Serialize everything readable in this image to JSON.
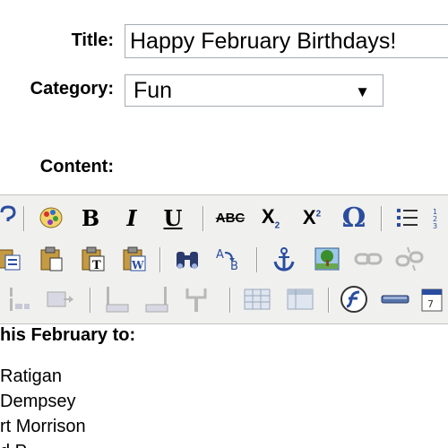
{
  "form": {
    "title_label": "Title:",
    "title_value": "Happy February Birthdays!",
    "category_label": "Category:",
    "category_value": "Fun",
    "content_label": "Content:"
  },
  "toolbar": {
    "row1": [
      "help-icon",
      "colors-icon",
      "bold",
      "italic",
      "underline",
      "strikethrough",
      "subscript",
      "superscript",
      "special-char",
      "bulleted-list",
      "numbered-list"
    ],
    "row2": [
      "paste-icon",
      "paste-icon",
      "paste-text-icon",
      "paste-word-icon",
      "find-icon",
      "replace-icon",
      "anchor-icon",
      "image-icon",
      "link-icon",
      "unlink-icon"
    ],
    "row3": [
      "table-row-icon",
      "table-col-icon",
      "table-merge-icon",
      "table-split-icon",
      "table-insert-icon",
      "table-icon",
      "table-props-icon",
      "flash-icon",
      "horizontal-rule-icon",
      "date-icon"
    ],
    "bold_glyph": "B",
    "italic_glyph": "I",
    "underline_glyph": "U",
    "strike_glyph": "ABC",
    "sub_glyph": "X",
    "sub_small": "2",
    "sup_glyph": "X",
    "sup_small": "2",
    "omega_glyph": "Ω"
  },
  "editor": {
    "heading": "his February to:",
    "names": [
      " Ratigan",
      "Dempsey",
      "rt Morrison",
      "d P"
    ]
  }
}
